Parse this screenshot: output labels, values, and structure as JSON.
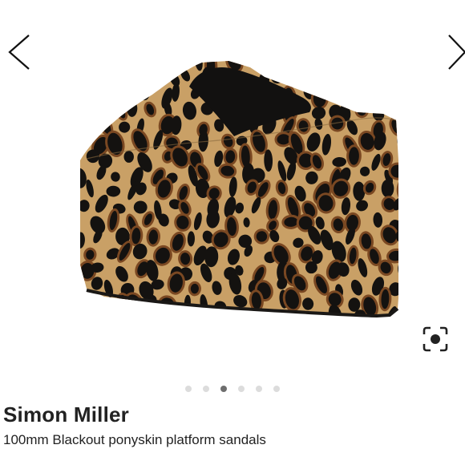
{
  "brand": "Simon Miller",
  "product_title": "100mm Blackout ponyskin platform sandals",
  "gallery": {
    "current_index": 3,
    "total_images": 6,
    "print_colors": {
      "base": "#c9a066",
      "spot": "#141210",
      "halo": "#7a4822"
    }
  },
  "icons": {
    "prev": "chevron-left-icon",
    "next": "chevron-right-icon",
    "visual_search": "visual-search-icon"
  }
}
